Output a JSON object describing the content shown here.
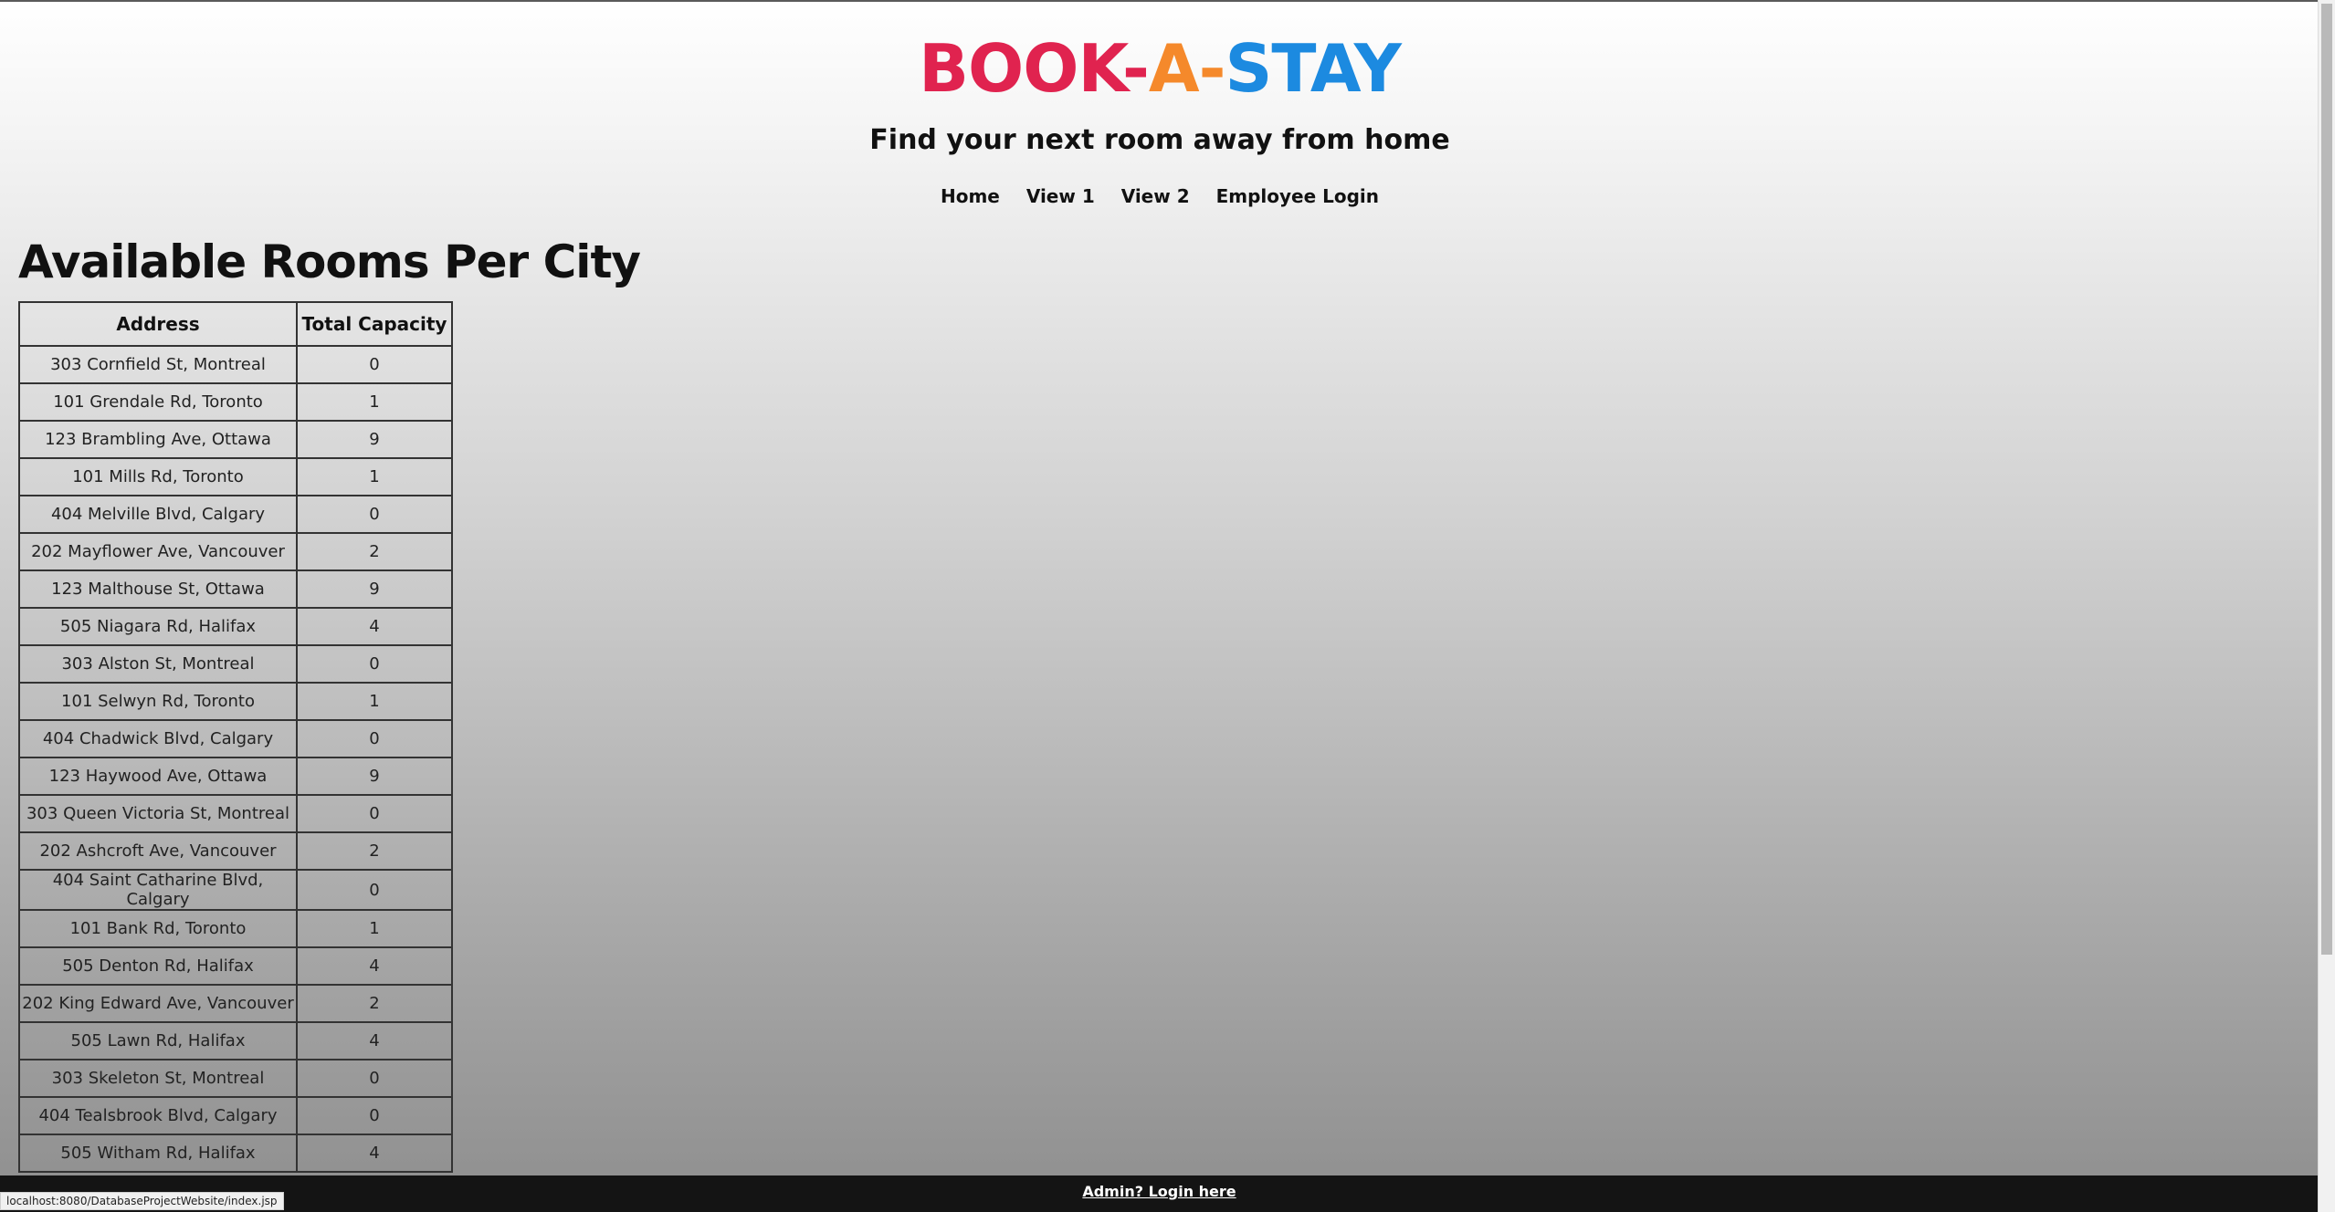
{
  "header": {
    "logo": {
      "part1": "BOOK-",
      "part2": "A-",
      "part3": "STAY"
    },
    "tagline": "Find your next room away from home",
    "nav": [
      "Home",
      "View 1",
      "View 2",
      "Employee Login"
    ]
  },
  "main": {
    "title": "Available Rooms Per City",
    "table": {
      "headers": [
        "Address",
        "Total Capacity"
      ],
      "rows": [
        [
          "303 Cornfield St, Montreal",
          "0"
        ],
        [
          "101 Grendale Rd, Toronto",
          "1"
        ],
        [
          "123 Brambling Ave, Ottawa",
          "9"
        ],
        [
          "101 Mills Rd, Toronto",
          "1"
        ],
        [
          "404 Melville Blvd, Calgary",
          "0"
        ],
        [
          "202 Mayflower Ave, Vancouver",
          "2"
        ],
        [
          "123 Malthouse St, Ottawa",
          "9"
        ],
        [
          "505 Niagara Rd, Halifax",
          "4"
        ],
        [
          "303 Alston St, Montreal",
          "0"
        ],
        [
          "101 Selwyn Rd, Toronto",
          "1"
        ],
        [
          "404 Chadwick Blvd, Calgary",
          "0"
        ],
        [
          "123 Haywood Ave, Ottawa",
          "9"
        ],
        [
          "303 Queen Victoria St, Montreal",
          "0"
        ],
        [
          "202 Ashcroft Ave, Vancouver",
          "2"
        ],
        [
          "404 Saint Catharine Blvd, Calgary",
          "0"
        ],
        [
          "101 Bank Rd, Toronto",
          "1"
        ],
        [
          "505 Denton Rd, Halifax",
          "4"
        ],
        [
          "202 King Edward Ave, Vancouver",
          "2"
        ],
        [
          "505 Lawn Rd, Halifax",
          "4"
        ],
        [
          "303 Skeleton St, Montreal",
          "0"
        ],
        [
          "404 Tealsbrook Blvd, Calgary",
          "0"
        ],
        [
          "505 Witham Rd, Halifax",
          "4"
        ]
      ]
    }
  },
  "footer": {
    "admin_link": "Admin? Login here"
  },
  "status_bar": {
    "url": "localhost:8080/DatabaseProjectWebsite/index.jsp"
  },
  "colors": {
    "logo_red": "#e0234f",
    "logo_orange": "#f5892b",
    "logo_blue": "#1c8ae0",
    "footer_bg": "#141414"
  }
}
